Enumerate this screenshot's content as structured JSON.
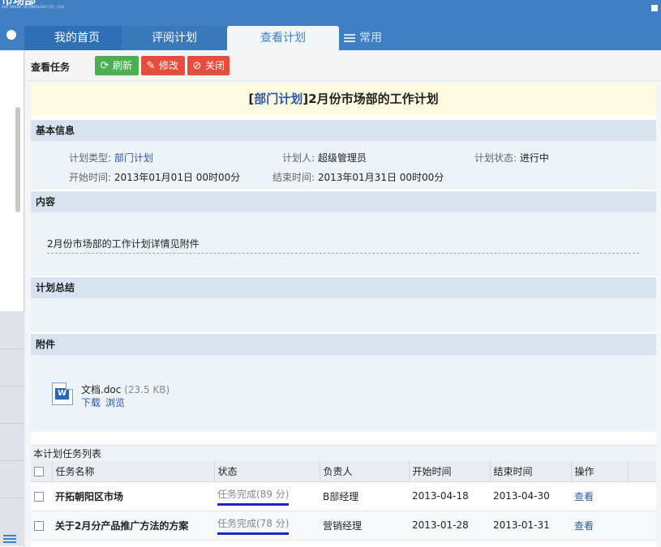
{
  "header": {
    "logo_text": "市场部",
    "logo_sub": "SOFTWARE TECHNOLOGY CO., LTD."
  },
  "nav": {
    "tabs": [
      {
        "label": "我的首页"
      },
      {
        "label": "评阅计划"
      },
      {
        "label": "查看计划",
        "active": true
      },
      {
        "label": "常用"
      }
    ]
  },
  "toolbar": {
    "title": "查看任务",
    "refresh": "刷新",
    "edit": "修改",
    "close": "关闭"
  },
  "plan": {
    "category": "部门计划",
    "title": "2月份市场部的工作计划",
    "sections": {
      "basic": "基本信息",
      "content": "内容",
      "summary": "计划总结",
      "attachments": "附件"
    },
    "info": {
      "type_label": "计划类型:",
      "type_value": "部门计划",
      "owner_label": "计划人:",
      "owner_value": "超级管理员",
      "status_label": "计划状态:",
      "status_value": "进行中",
      "start_label": "开始时间:",
      "start_value": "2013年01月01日 00时00分",
      "end_label": "结束时间:",
      "end_value": "2013年01月31日 00时00分"
    },
    "content_text": "2月份市场部的工作计划详情见附件",
    "attachment": {
      "name": "文档.doc",
      "size": "(23.5 KB)",
      "download": "下载",
      "preview": "浏览"
    }
  },
  "tasks": {
    "caption": "本计划任务列表",
    "columns": [
      "任务名称",
      "状态",
      "负责人",
      "开始时间",
      "结束时间",
      "操作"
    ],
    "rows": [
      {
        "name": "开拓朝阳区市场",
        "status": "任务完成(89 分)",
        "owner": "B部经理",
        "start": "2013-04-18",
        "end": "2013-04-30",
        "action": "查看"
      },
      {
        "name": "关于2月分产品推广方法的方案",
        "status": "任务完成(78 分)",
        "owner": "营销经理",
        "start": "2013-01-28",
        "end": "2013-01-31",
        "action": "查看"
      }
    ]
  },
  "colors": {
    "nav_blue": "#3f7fc4",
    "refresh_green": "#4caf50",
    "danger_red": "#e84c3d",
    "link_blue": "#2f57a5",
    "underline_blue": "#1a26c9"
  }
}
